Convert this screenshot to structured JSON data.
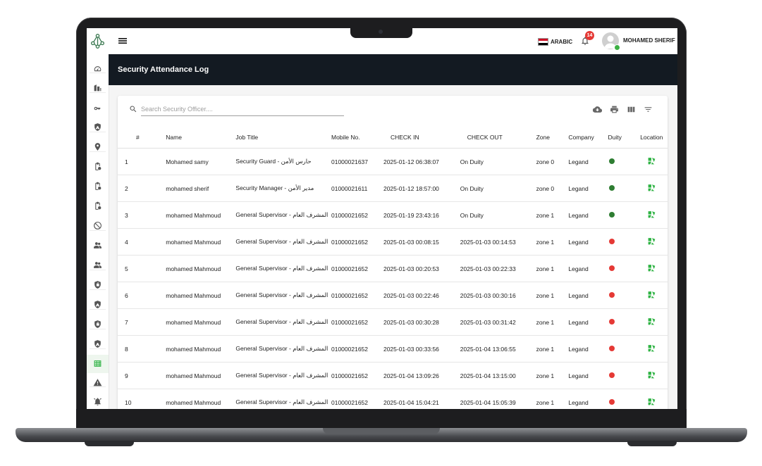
{
  "app": {
    "page_title": "Security Attendance Log",
    "language_label": "ARABIC",
    "notification_count": "14",
    "user_name": "MOHAMED SHERIF"
  },
  "colors": {
    "title_band": "#131a22",
    "on_duty": "#2e7d32",
    "off_duty": "#e53935",
    "location_icon": "#2fb344",
    "badge": "#e53935"
  },
  "sidebar": {
    "items": [
      {
        "icon": "dashboard-gauge-icon"
      },
      {
        "icon": "buildings-icon"
      },
      {
        "icon": "key-icon"
      },
      {
        "icon": "shield-icon"
      },
      {
        "icon": "location-pin-icon"
      },
      {
        "icon": "clipboard-icon"
      },
      {
        "icon": "clipboard-icon"
      },
      {
        "icon": "clipboard-icon"
      },
      {
        "icon": "block-icon"
      },
      {
        "icon": "people-icon"
      },
      {
        "icon": "people-icon"
      },
      {
        "icon": "lock-shield-icon"
      },
      {
        "icon": "shield-icon"
      },
      {
        "icon": "lock-shield-icon"
      },
      {
        "icon": "shield-icon"
      },
      {
        "icon": "table-grid-icon",
        "active": true
      },
      {
        "icon": "warning-icon"
      },
      {
        "icon": "alarm-bell-icon"
      }
    ]
  },
  "search": {
    "placeholder": "Search Security Officer...."
  },
  "toolbar": [
    "cloud-download-icon",
    "print-icon",
    "view-columns-icon",
    "filter-icon"
  ],
  "table": {
    "headers": [
      "#",
      "Name",
      "Job Title",
      "Mobile No.",
      "CHECK IN",
      "CHECK OUT",
      "Zone",
      "Company",
      "Duity",
      "Location"
    ],
    "rows": [
      {
        "n": "1",
        "name": "Mohamed samy",
        "job": "Security Guard - حارس الأمن",
        "mobile": "01000021637",
        "in": "2025-01-12 06:38:07",
        "out": "On Duity",
        "zone": "zone 0",
        "company": "Legand",
        "duty": "on"
      },
      {
        "n": "2",
        "name": "mohamed sherif",
        "job": "Security Manager - مدير الأمن",
        "mobile": "01000021611",
        "in": "2025-01-12 18:57:00",
        "out": "On Duity",
        "zone": "zone 0",
        "company": "Legand",
        "duty": "on"
      },
      {
        "n": "3",
        "name": "mohamed Mahmoud",
        "job": "General Supervisor - المشرف العام",
        "mobile": "01000021652",
        "in": "2025-01-19 23:43:16",
        "out": "On Duity",
        "zone": "zone 1",
        "company": "Legand",
        "duty": "on"
      },
      {
        "n": "4",
        "name": "mohamed Mahmoud",
        "job": "General Supervisor - المشرف العام",
        "mobile": "01000021652",
        "in": "2025-01-03 00:08:15",
        "out": "2025-01-03 00:14:53",
        "zone": "zone 1",
        "company": "Legand",
        "duty": "off"
      },
      {
        "n": "5",
        "name": "mohamed Mahmoud",
        "job": "General Supervisor - المشرف العام",
        "mobile": "01000021652",
        "in": "2025-01-03 00:20:53",
        "out": "2025-01-03 00:22:33",
        "zone": "zone 1",
        "company": "Legand",
        "duty": "off"
      },
      {
        "n": "6",
        "name": "mohamed Mahmoud",
        "job": "General Supervisor - المشرف العام",
        "mobile": "01000021652",
        "in": "2025-01-03 00:22:46",
        "out": "2025-01-03 00:30:16",
        "zone": "zone 1",
        "company": "Legand",
        "duty": "off"
      },
      {
        "n": "7",
        "name": "mohamed Mahmoud",
        "job": "General Supervisor - المشرف العام",
        "mobile": "01000021652",
        "in": "2025-01-03 00:30:28",
        "out": "2025-01-03 00:31:42",
        "zone": "zone 1",
        "company": "Legand",
        "duty": "off"
      },
      {
        "n": "8",
        "name": "mohamed Mahmoud",
        "job": "General Supervisor - المشرف العام",
        "mobile": "01000021652",
        "in": "2025-01-03 00:33:56",
        "out": "2025-01-04 13:06:55",
        "zone": "zone 1",
        "company": "Legand",
        "duty": "off"
      },
      {
        "n": "9",
        "name": "mohamed Mahmoud",
        "job": "General Supervisor - المشرف العام",
        "mobile": "01000021652",
        "in": "2025-01-04 13:09:26",
        "out": "2025-01-04 13:15:00",
        "zone": "zone 1",
        "company": "Legand",
        "duty": "off"
      },
      {
        "n": "10",
        "name": "mohamed Mahmoud",
        "job": "General Supervisor - المشرف العام",
        "mobile": "01000021652",
        "in": "2025-01-04 15:04:21",
        "out": "2025-01-04 15:05:39",
        "zone": "zone 1",
        "company": "Legand",
        "duty": "off"
      }
    ]
  }
}
